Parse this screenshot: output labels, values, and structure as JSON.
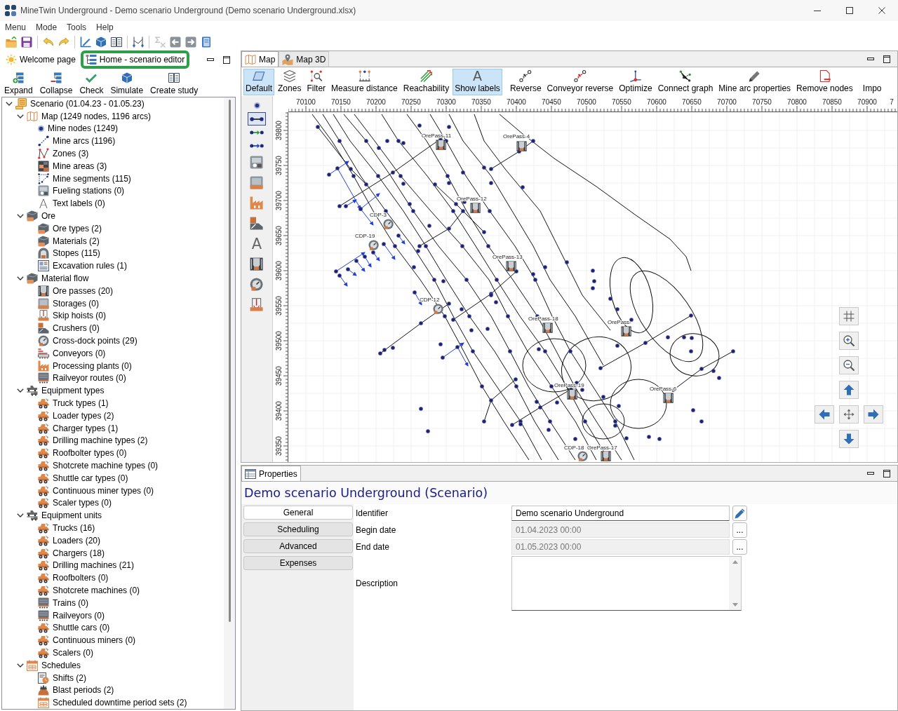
{
  "window": {
    "title": "MineTwin Underground - Demo scenario Underground (Demo scenario Underground.xlsx)"
  },
  "menu": [
    "Menu",
    "Mode",
    "Tools",
    "Help"
  ],
  "toolbar": [
    {
      "disabled": false
    },
    {
      "disabled": false
    },
    {
      "disabled": false
    },
    {
      "disabled": false
    },
    {
      "disabled": false
    },
    {
      "disabled": false
    },
    {
      "disabled": false
    },
    {
      "disabled": false
    },
    {
      "disabled": true
    },
    {
      "disabled": false
    },
    {
      "disabled": false
    },
    {
      "disabled": false
    }
  ],
  "left_panel": {
    "tabs": [
      {
        "label": "Welcome page",
        "selected": false
      },
      {
        "label": "Home - scenario editor",
        "selected": true
      }
    ],
    "actions": [
      "Expand",
      "Collapse",
      "Check",
      "Simulate",
      "Create study"
    ],
    "tree": [
      {
        "label": "Scenario (01.04.23 - 01.05.23)",
        "expanded": true,
        "children": [
          {
            "label": "Map (1249 nodes, 1196 arcs)",
            "expanded": true,
            "children": [
              {
                "label": "Mine nodes (1249)"
              },
              {
                "label": "Mine arcs (1196)"
              },
              {
                "label": "Zones (3)"
              },
              {
                "label": "Mine areas (3)"
              },
              {
                "label": "Mine segments (115)"
              },
              {
                "label": "Fueling stations (0)"
              },
              {
                "label": "Text labels (0)",
                "glyph": "A"
              }
            ]
          },
          {
            "label": "Ore",
            "expanded": true,
            "children": [
              {
                "label": "Ore types (2)"
              },
              {
                "label": "Materials (2)"
              },
              {
                "label": "Stopes (115)"
              },
              {
                "label": "Excavation rules (1)"
              }
            ]
          },
          {
            "label": "Material flow",
            "expanded": true,
            "children": [
              {
                "label": "Ore passes (20)"
              },
              {
                "label": "Storages (0)"
              },
              {
                "label": "Skip hoists (0)"
              },
              {
                "label": "Crushers (0)"
              },
              {
                "label": "Cross-dock points (29)"
              },
              {
                "label": "Conveyors (0)"
              },
              {
                "label": "Processing plants (0)"
              },
              {
                "label": "Railveyor routes (0)"
              }
            ]
          },
          {
            "label": "Equipment types",
            "expanded": true,
            "children": [
              {
                "label": "Truck types (1)"
              },
              {
                "label": "Loader types (2)"
              },
              {
                "label": "Charger types (1)"
              },
              {
                "label": "Drilling machine types (2)"
              },
              {
                "label": "Roofbolter types (0)"
              },
              {
                "label": "Shotcrete machine types (0)"
              },
              {
                "label": "Shuttle car types (0)"
              },
              {
                "label": "Continuous miner types (0)"
              },
              {
                "label": "Scaler types (0)"
              }
            ]
          },
          {
            "label": "Equipment units",
            "expanded": true,
            "children": [
              {
                "label": "Trucks (16)"
              },
              {
                "label": "Loaders (20)"
              },
              {
                "label": "Chargers (18)"
              },
              {
                "label": "Drilling machines (21)"
              },
              {
                "label": "Roofbolters (0)"
              },
              {
                "label": "Shotcrete machines (0)"
              },
              {
                "label": "Trains (0)"
              },
              {
                "label": "Railveyors (0)"
              },
              {
                "label": "Shuttle cars (0)"
              },
              {
                "label": "Continuous miners (0)"
              },
              {
                "label": "Scalers (0)"
              }
            ]
          },
          {
            "label": "Schedules",
            "expanded": true,
            "children": [
              {
                "label": "Shifts (2)"
              },
              {
                "label": "Blast periods (2)"
              },
              {
                "label": "Scheduled downtime period sets (2)"
              }
            ]
          }
        ]
      }
    ]
  },
  "map_panel": {
    "tabs": [
      {
        "label": "Map",
        "selected": true
      },
      {
        "label": "Map 3D",
        "selected": false
      }
    ],
    "tools": [
      {
        "label": "Default",
        "selected": true
      },
      {
        "label": "Zones",
        "selected": false
      },
      {
        "label": "Filter",
        "selected": false
      },
      {
        "label": "Measure distance",
        "selected": false
      },
      {
        "label": "Reachability",
        "selected": false
      },
      {
        "glyph": "A",
        "label": "Show labels",
        "selected": true
      },
      {
        "label": "Reverse",
        "selected": false
      },
      {
        "label": "Conveyor reverse",
        "selected": false
      },
      {
        "label": "Optimize",
        "selected": false
      },
      {
        "label": "Connect graph",
        "selected": false
      },
      {
        "label": "Mine arc properties",
        "selected": false
      },
      {
        "label": "Remove nodes",
        "selected": false
      },
      {
        "label": "Impo",
        "selected": false
      }
    ],
    "palette": [
      {
        "selected": false
      },
      {
        "selected": true
      },
      {
        "selected": false
      },
      {
        "selected": false
      },
      {
        "selected": false
      },
      {
        "selected": false
      },
      {
        "selected": false
      },
      {
        "selected": false
      },
      {
        "glyph": "A",
        "selected": false
      },
      {
        "selected": false
      },
      {
        "selected": false
      },
      {
        "selected": false
      }
    ],
    "x_ruler": [
      "70100",
      "70150",
      "70200",
      "70250",
      "70300",
      "70350",
      "70400",
      "70450",
      "70500",
      "70550",
      "70600",
      "70650",
      "70700",
      "70750",
      "70800",
      "70850",
      "70900",
      "7"
    ],
    "y_ruler": [
      "39800",
      "39750",
      "39700",
      "39650",
      "39600",
      "39550",
      "39500",
      "39450",
      "39400",
      "39350"
    ],
    "labels": [
      "OrePass-11",
      "OrePass-4",
      "OrePass-12",
      "CDP-3",
      "CDP-19",
      "OrePass-13",
      "CDP-12",
      "OrePass-18",
      "OrePass-",
      "OrePass-19",
      "OrePass-6",
      "CDP-18",
      "OrePass-17"
    ]
  },
  "properties": {
    "tab": "Properties",
    "title": "Demo scenario Underground (Scenario)",
    "sections": [
      {
        "label": "General",
        "selected": true
      },
      {
        "label": "Scheduling",
        "selected": false
      },
      {
        "label": "Advanced",
        "selected": false
      },
      {
        "label": "Expenses",
        "selected": false
      }
    ],
    "fields": [
      {
        "kind": "text",
        "label": "Identifier",
        "value": "Demo scenario Underground",
        "disabled": false
      },
      {
        "kind": "date",
        "label": "Begin date",
        "value": "01.04.2023 00:00",
        "disabled": true,
        "button": "..."
      },
      {
        "kind": "date",
        "label": "End date",
        "value": "01.05.2023 00:00",
        "disabled": true,
        "button": "..."
      },
      {
        "kind": "textarea",
        "label": "Description"
      }
    ]
  }
}
